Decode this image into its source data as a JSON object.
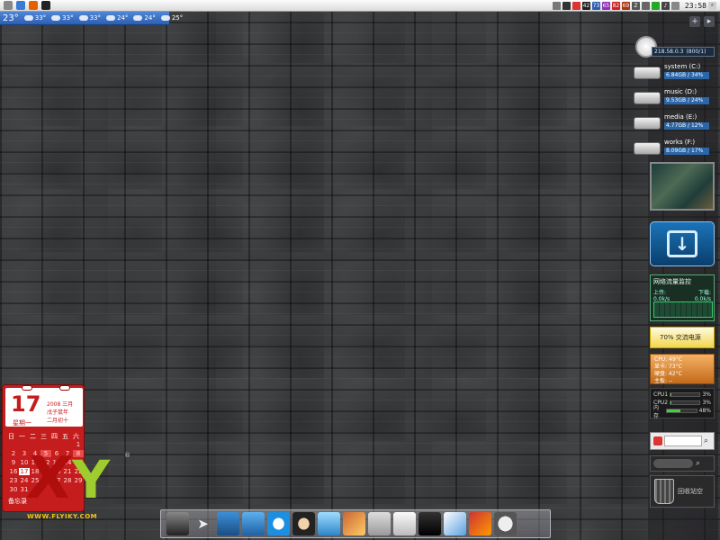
{
  "menubar": {
    "clock": "23:58",
    "tray_numbers": [
      "42",
      "73",
      "65",
      "82",
      "69"
    ]
  },
  "weather": {
    "current_temp": "23°",
    "forecast": [
      "33°",
      "33°",
      "33°",
      "24°",
      "24°",
      "25°"
    ]
  },
  "sidebar": {
    "ip": "218.58.0.3",
    "ip_note": "(800/1)",
    "drives": [
      {
        "name": "system (C:)",
        "info": "6.84GB / 34%"
      },
      {
        "name": "music (D:)",
        "info": "9.53GB / 24%"
      },
      {
        "name": "media (E:)",
        "info": "4.77GB / 12%"
      },
      {
        "name": "works (F:)",
        "info": "8.09GB / 17%"
      }
    ],
    "net_title": "网络流量监控",
    "net_up_label": "上传:",
    "net_down_label": "下载:",
    "net_up_val": "0.0k/s",
    "net_down_val": "0.0k/s",
    "power_text": "70% 交流电源",
    "temp_lines": [
      "CPU: 49°C",
      "显卡: 73°C",
      "硬盘: 42°C",
      "主板: --"
    ],
    "cpu1_label": "CPU1",
    "cpu1_val": "3%",
    "cpu1_pct": 3,
    "cpu2_label": "CPU2",
    "cpu2_val": "3%",
    "cpu2_pct": 3,
    "mem_label": "内存",
    "mem_val": "48%",
    "mem_pct": 48,
    "trash_label": "回收站空"
  },
  "calendar": {
    "day": "17",
    "weekday": "星期一",
    "year_month": "2008 三月",
    "lunar_year": "戊子鼠年",
    "lunar_day": "二月初十",
    "weekdays": [
      "日",
      "一",
      "二",
      "三",
      "四",
      "五",
      "六"
    ],
    "days": [
      "",
      "",
      "",
      "",
      "",
      "",
      "1",
      "2",
      "3",
      "4",
      "5",
      "6",
      "7",
      "8",
      "9",
      "10",
      "11",
      "12",
      "13",
      "14",
      "15",
      "16",
      "17",
      "18",
      "19",
      "20",
      "21",
      "22",
      "23",
      "24",
      "25",
      "26",
      "27",
      "28",
      "29",
      "30",
      "31",
      "",
      "",
      "",
      "",
      ""
    ],
    "memo": "备忘录"
  },
  "logo": {
    "url": "WWW.FLYIKY.COM",
    "registered": "®"
  },
  "dock": {
    "icons": [
      "laptop-icon",
      "paper-plane-icon",
      "dolphin-icon",
      "bird-icon",
      "doraemon-icon",
      "astro-boy-icon",
      "monitor-icon",
      "photos-icon",
      "network-icon",
      "ipod-icon",
      "dashboard-icon",
      "feather-icon",
      "media-icon",
      "skull-icon"
    ]
  }
}
